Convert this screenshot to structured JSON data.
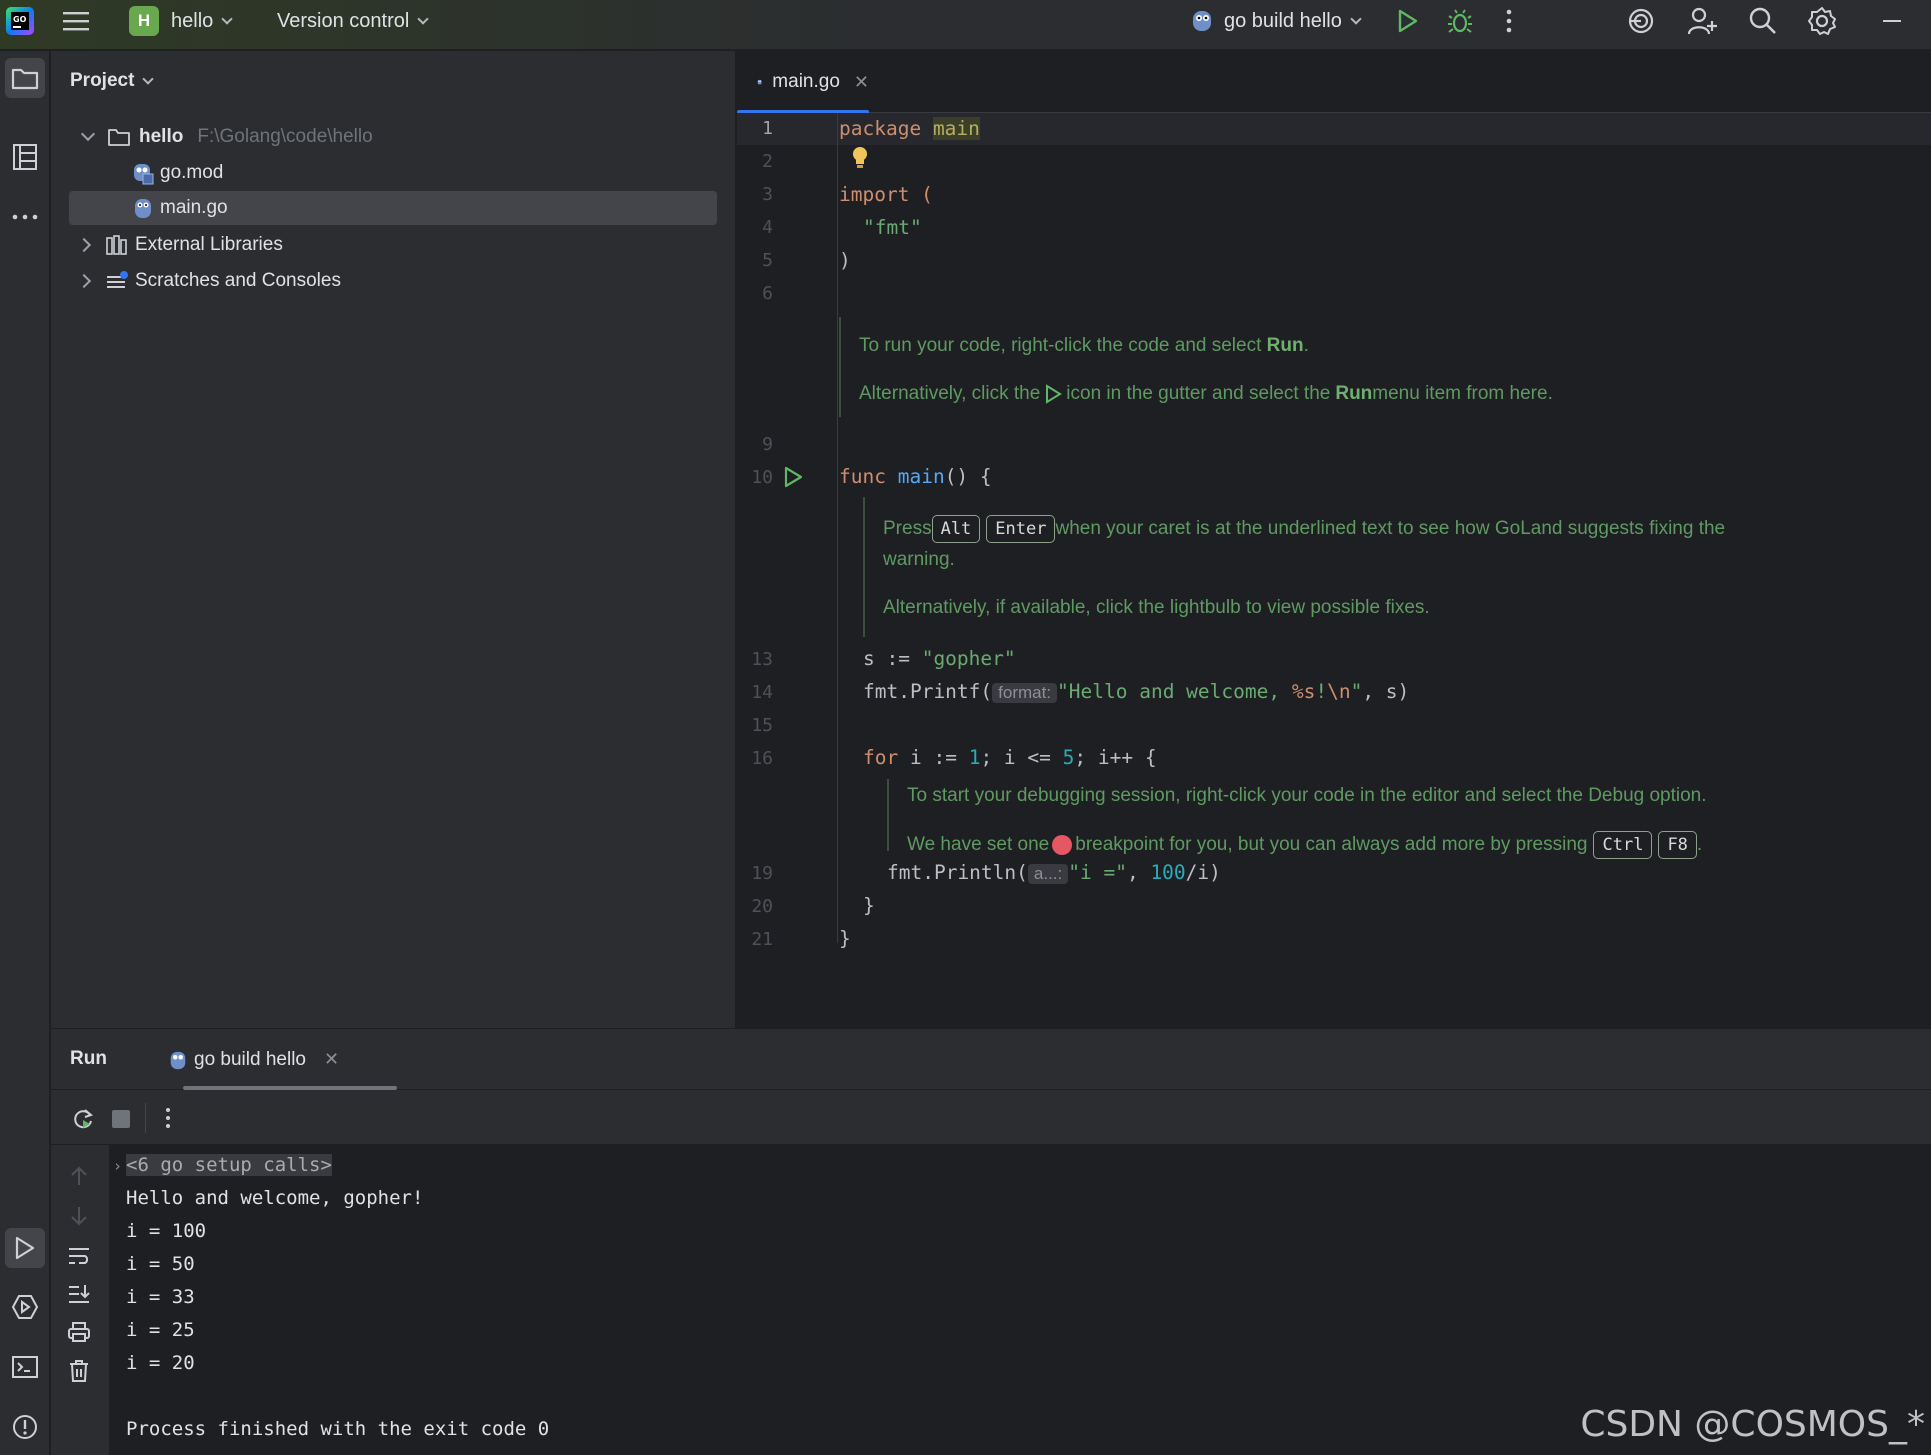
{
  "titlebar": {
    "project_badge": "H",
    "project_name": "hello",
    "vcs_label": "Version control",
    "run_config": "go build hello",
    "icons": [
      "goland-logo-icon",
      "hamburger-menu-icon",
      "run-icon",
      "debug-icon",
      "more-vertical-icon",
      "ai-assistant-icon",
      "add-user-icon",
      "search-icon",
      "gear-icon",
      "minimize-icon"
    ]
  },
  "project_panel": {
    "title": "Project",
    "tree": [
      {
        "label": "hello",
        "hint": "F:\\Golang\\code\\hello"
      },
      {
        "label": "go.mod"
      },
      {
        "label": "main.go"
      },
      {
        "label": "External Libraries"
      },
      {
        "label": "Scratches and Consoles"
      }
    ]
  },
  "editor": {
    "tab_label": "main.go",
    "line_numbers": [
      "1",
      "2",
      "3",
      "4",
      "5",
      "6",
      "9",
      "10",
      "13",
      "14",
      "15",
      "16",
      "19",
      "20",
      "21"
    ],
    "code": {
      "l1_kw": "package",
      "l1_name": "main",
      "l3": "import (",
      "l4": "\"fmt\"",
      "l5": ")",
      "l10_kw": "func",
      "l10_fn": "main",
      "l10_rest": "() {",
      "l13_a": "s := ",
      "l13_str": "\"gopher\"",
      "l14_a": "fmt.Printf(",
      "l14_hint": "format:",
      "l14_str_a": "\"Hello and welcome, ",
      "l14_esc1": "%s",
      "l14_str_b": "!",
      "l14_esc2": "\\n",
      "l14_str_c": "\"",
      "l14_rest": ", s)",
      "l16_kw": "for",
      "l16_a": " i := ",
      "l16_n1": "1",
      "l16_b": "; i <= ",
      "l16_n2": "5",
      "l16_c": "; i++ {",
      "l19_a": "fmt.Println(",
      "l19_hint": "a...:",
      "l19_str": "\"i =\"",
      "l19_b": ", ",
      "l19_num": "100",
      "l19_c": "/i)",
      "l20": "}",
      "l21": "}"
    },
    "doc1": {
      "p1_a": "To run your code, right-click the code and select ",
      "p1_b": "Run",
      "p1_c": ".",
      "p2_a": "Alternatively, click the ",
      "p2_b": " icon in the gutter and select the ",
      "p2_c": "Run",
      "p2_d": " menu item from here."
    },
    "doc2": {
      "p1_a": "Press ",
      "key1": "Alt",
      "key2": "Enter",
      "p1_b": " when your caret is at the underlined text to see how GoLand suggests fixing the",
      "p1_c": "warning.",
      "p2": "Alternatively, if available, click the lightbulb to view possible fixes."
    },
    "doc3": {
      "p1": "To start your debugging session, right-click your code in the editor and select the Debug option.",
      "p2_a": "We have set one ",
      "p2_b": " breakpoint for you, but you can always add more by pressing ",
      "key1": "Ctrl",
      "key2": "F8",
      "p2_c": "."
    }
  },
  "run_panel": {
    "title": "Run",
    "tab_label": "go build hello",
    "console": [
      "<6 go setup calls>",
      "Hello and welcome, gopher!",
      "i = 100",
      "i = 50",
      "i = 33",
      "i = 25",
      "i = 20",
      "",
      "Process finished with the exit code 0"
    ]
  },
  "watermark": "CSDN @COSMOS_*"
}
